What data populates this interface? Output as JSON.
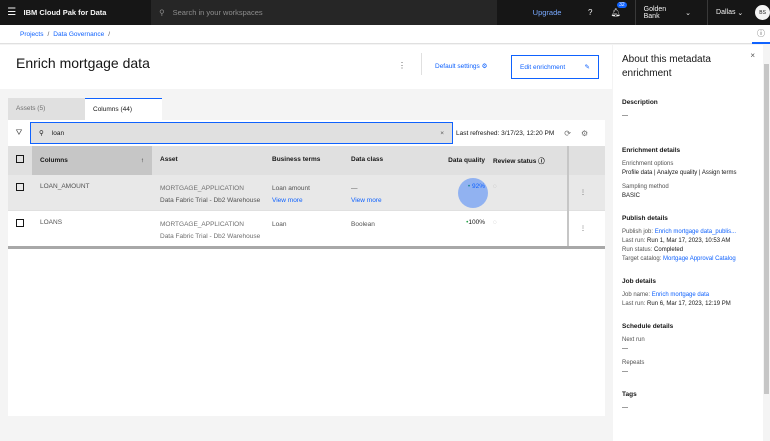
{
  "topbar": {
    "brand": "IBM Cloud Pak for Data",
    "search_placeholder": "Search in your workspaces",
    "upgrade": "Upgrade",
    "notification_count": "32",
    "account": "Golden Bank",
    "region": "Dallas",
    "avatar": "BS"
  },
  "breadcrumb": [
    "Projects",
    "Data Governance"
  ],
  "page": {
    "title": "Enrich mortgage data",
    "default_settings": "Default settings",
    "edit_enrichment": "Edit enrichment"
  },
  "tabs": [
    {
      "label": "Assets (5)"
    },
    {
      "label": "Columns (44)"
    }
  ],
  "toolbar": {
    "search_value": "loan",
    "last_refreshed": "Last refreshed: 3/17/23, 12:20 PM"
  },
  "table": {
    "headers": [
      "Columns",
      "Asset",
      "Business terms",
      "Data class",
      "Data quality",
      "Review status"
    ],
    "rows": [
      {
        "column": "LOAN_AMOUNT",
        "asset": "MORTGAGE_APPLICATION",
        "source": "Data Fabric Trial - Db2 Warehouse",
        "term": "Loan amount",
        "term_more": "View more",
        "class": "—",
        "class_more": "View more",
        "quality": "92%"
      },
      {
        "column": "LOANS",
        "asset": "MORTGAGE_APPLICATION",
        "source": "Data Fabric Trial - Db2 Warehouse",
        "term": "Loan",
        "class": "Boolean",
        "quality": "100%"
      }
    ]
  },
  "side": {
    "title": "About this metadata enrichment",
    "description_h": "Description",
    "description": "—",
    "enrich_h": "Enrichment details",
    "options_l": "Enrichment options",
    "options": "Profile data | Analyze quality | Assign terms",
    "sampling_l": "Sampling method",
    "sampling": "BASIC",
    "publish_h": "Publish details",
    "pub_job_l": "Publish job:",
    "pub_job": "Enrich mortgage data_publis...",
    "last_run_l": "Last run:",
    "last_run": "Run 1, Mar 17, 2023, 10:53 AM",
    "status_l": "Run status:",
    "status": "Completed",
    "catalog_l": "Target catalog:",
    "catalog": "Mortgage Approval Catalog",
    "job_h": "Job details",
    "job_name_l": "Job name:",
    "job_name": "Enrich mortgage data",
    "job_last_l": "Last run:",
    "job_last": "Run 6, Mar 17, 2023, 12:19 PM",
    "sched_h": "Schedule details",
    "next_l": "Next run",
    "next": "—",
    "repeats_l": "Repeats",
    "repeats": "—",
    "tags_h": "Tags",
    "tags": "—"
  }
}
